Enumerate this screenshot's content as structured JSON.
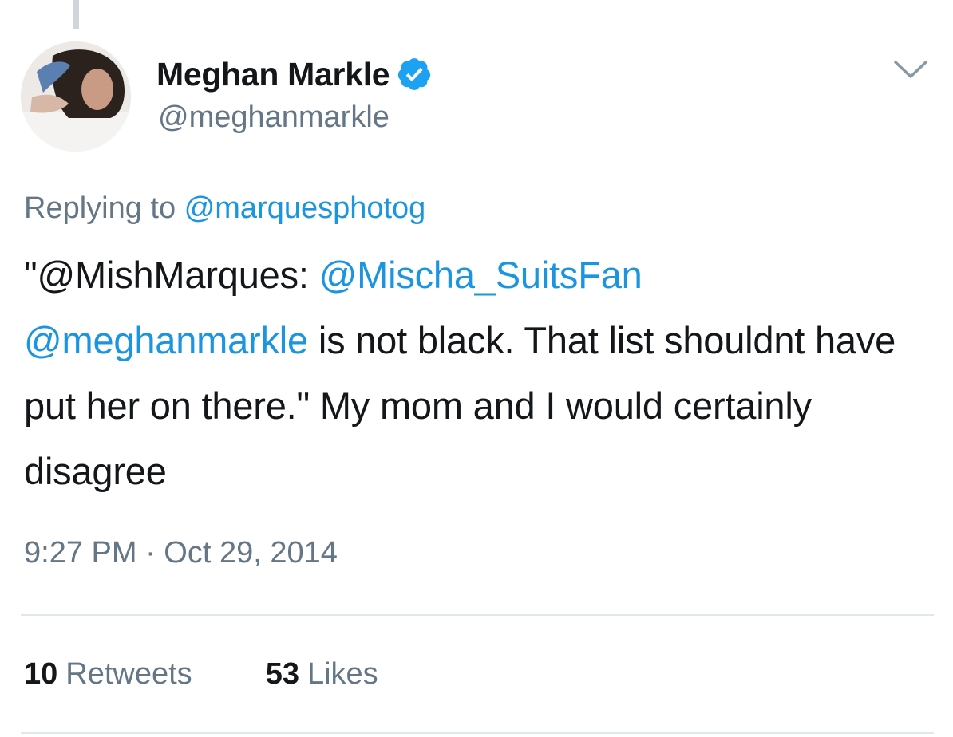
{
  "author": {
    "display_name": "Meghan Markle",
    "handle": "@meghanmarkle",
    "verified": true,
    "avatar_icon": "profile-photo"
  },
  "reply": {
    "prefix": "Replying to ",
    "to": "@marquesphotog"
  },
  "body": {
    "quote_open": "\"",
    "mention_1": "@MishMarques",
    "colon": ": ",
    "mention_2": "@Mischa_SuitsFan",
    "mention_3": "@meghanmarkle",
    "text": " is not black. That list shouldnt have put her on there.\" My mom and I would certainly disagree"
  },
  "timestamp": "9:27 PM · Oct 29, 2014",
  "stats": {
    "retweets_count": "10",
    "retweets_label": "Retweets",
    "likes_count": "53",
    "likes_label": "Likes"
  },
  "colors": {
    "link": "#1b95e0",
    "muted": "#657786",
    "verified": "#1da1f2"
  },
  "icons": [
    "verified-badge-icon",
    "chevron-down-icon"
  ]
}
